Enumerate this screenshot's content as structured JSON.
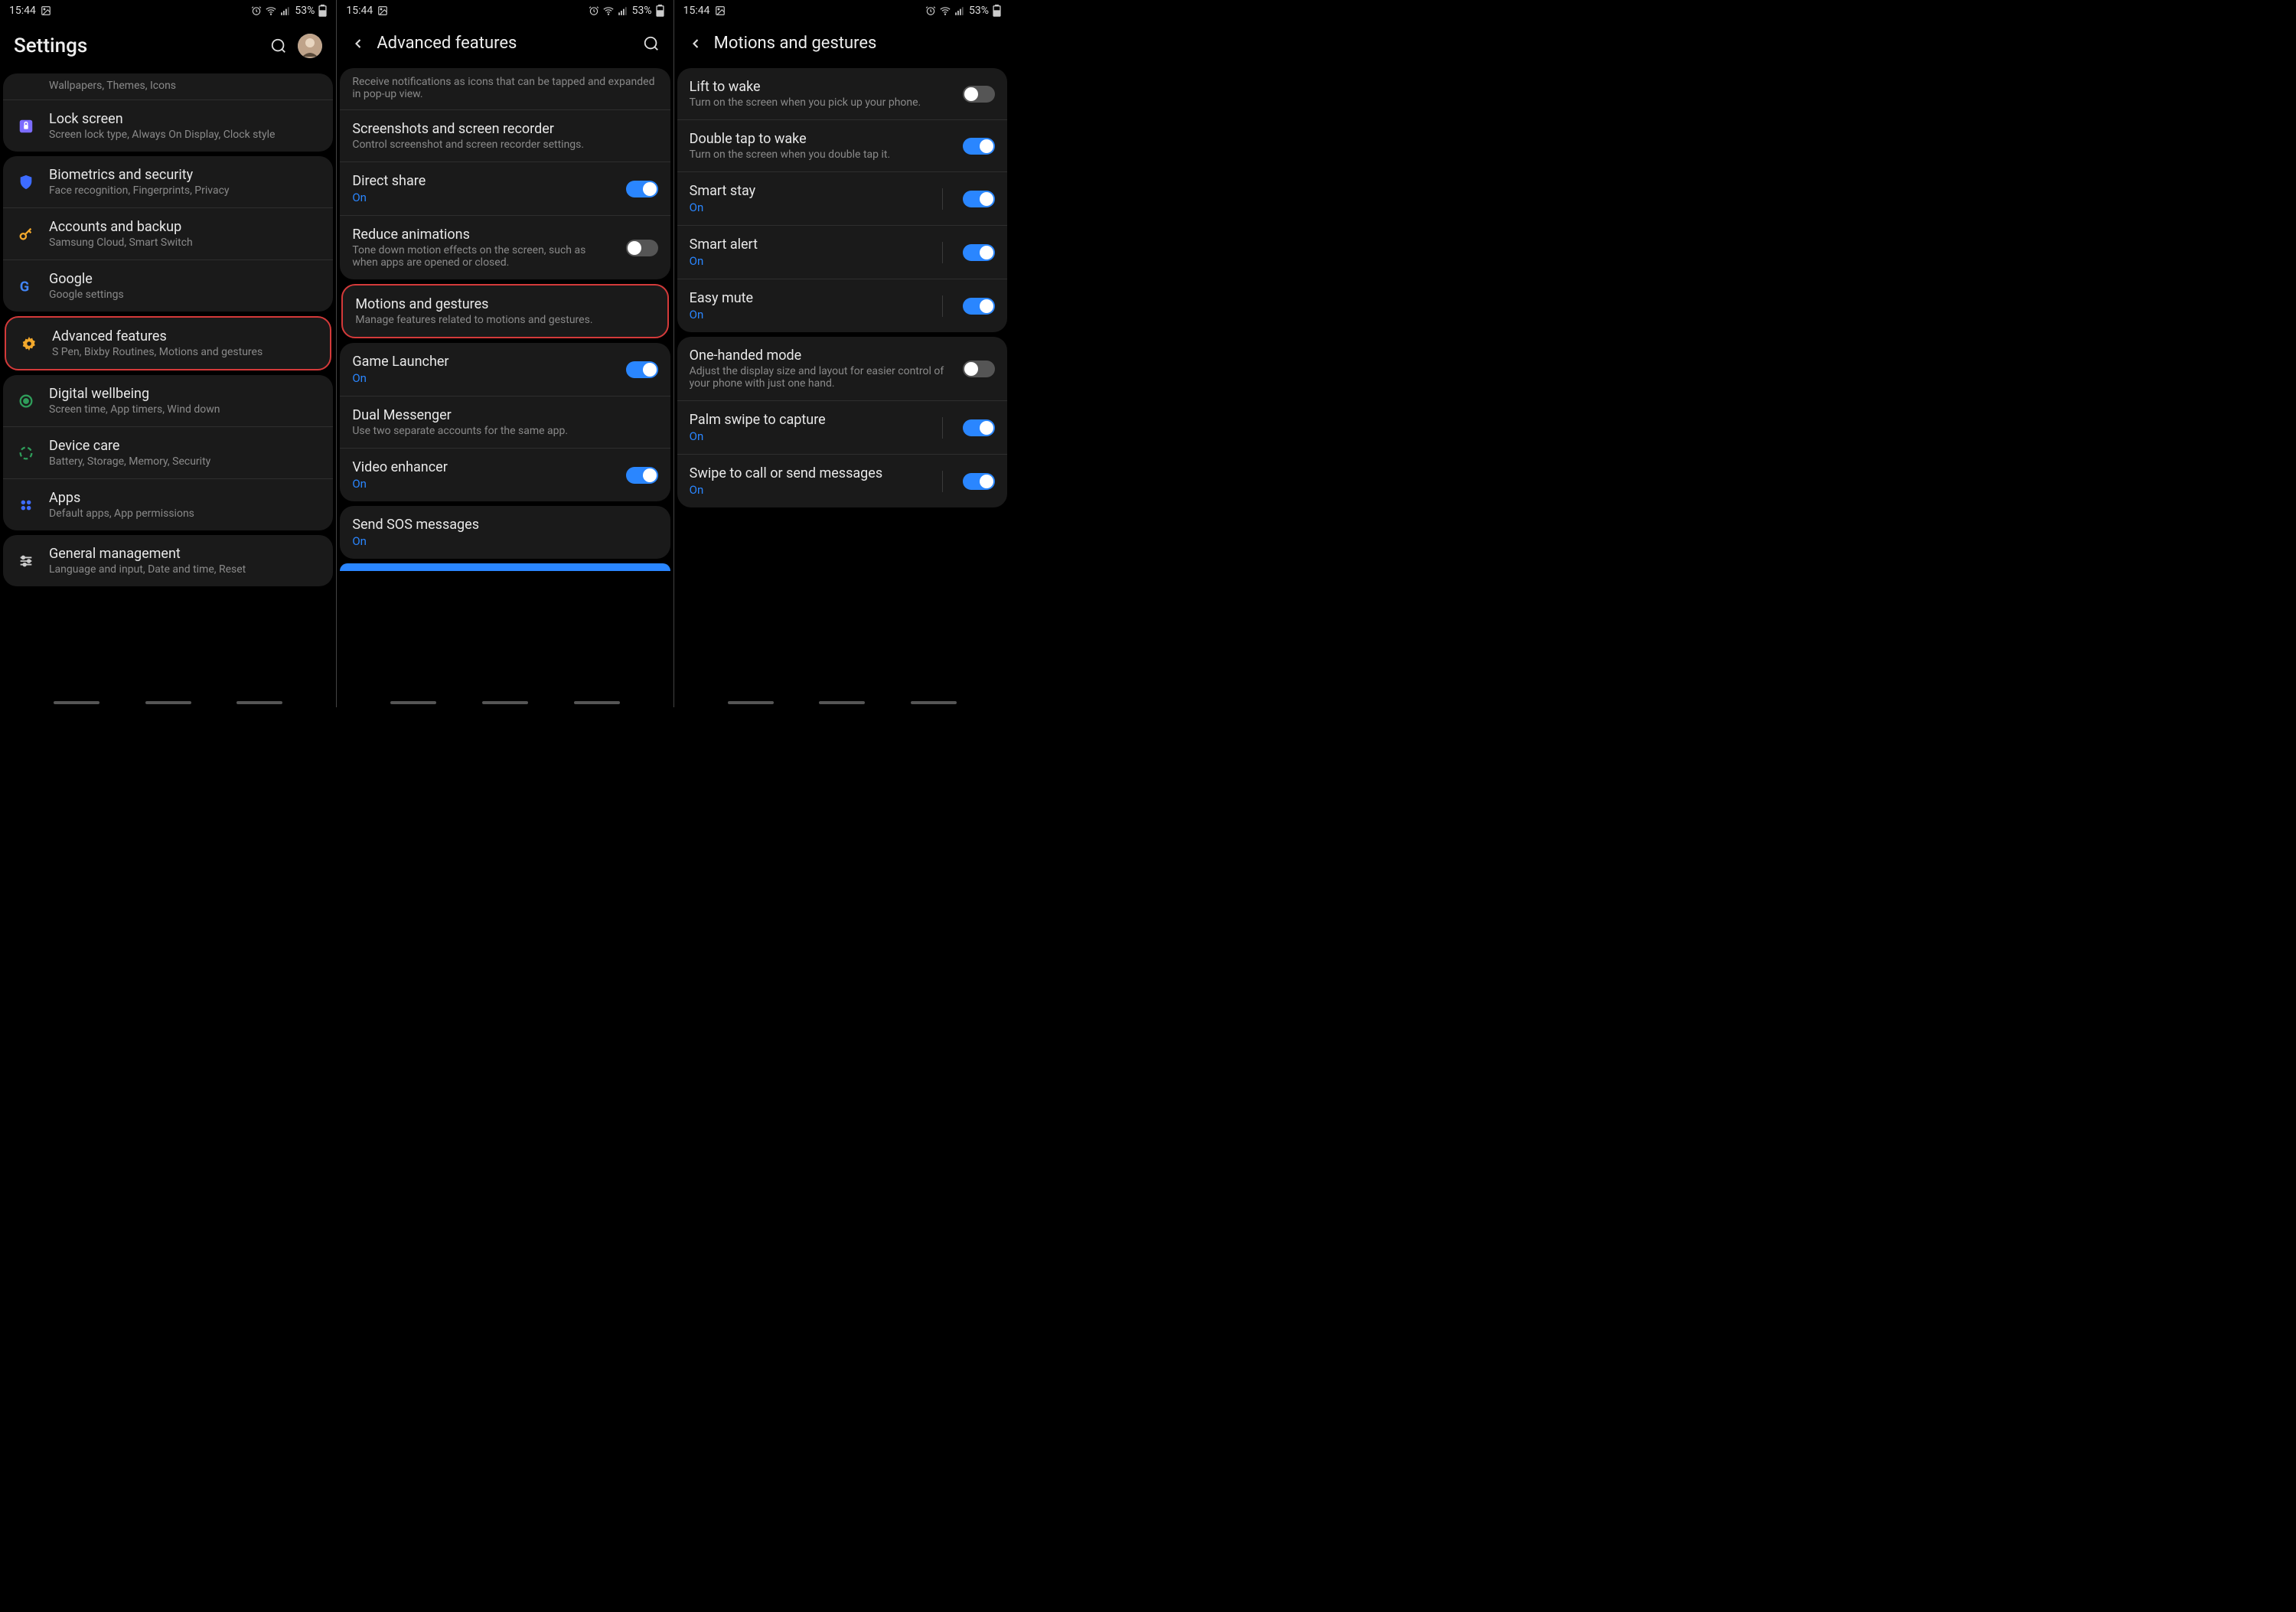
{
  "status": {
    "time": "15:44",
    "battery": "53%"
  },
  "colors": {
    "accent": "#2a86ff",
    "highlight": "#d43a3a"
  },
  "screen1": {
    "title": "Settings",
    "truncated_sub": "Wallpapers, Themes, Icons",
    "groups": [
      {
        "items": [
          {
            "icon": "lock-icon",
            "color": "#7c6cff",
            "title": "Lock screen",
            "sub": "Screen lock type, Always On Display, Clock style"
          }
        ]
      },
      {
        "items": [
          {
            "icon": "shield-icon",
            "color": "#3d6bff",
            "title": "Biometrics and security",
            "sub": "Face recognition, Fingerprints, Privacy"
          },
          {
            "icon": "key-icon",
            "color": "#f2a82c",
            "title": "Accounts and backup",
            "sub": "Samsung Cloud, Smart Switch"
          },
          {
            "icon": "google-icon",
            "color": "#4285f4",
            "title": "Google",
            "sub": "Google settings"
          }
        ]
      },
      {
        "highlight": true,
        "items": [
          {
            "icon": "gear-icon",
            "color": "#f2a82c",
            "title": "Advanced features",
            "sub": "S Pen, Bixby Routines, Motions and gestures"
          }
        ]
      },
      {
        "items": [
          {
            "icon": "wellbeing-icon",
            "color": "#2f9d5a",
            "title": "Digital wellbeing",
            "sub": "Screen time, App timers, Wind down"
          },
          {
            "icon": "care-icon",
            "color": "#2f9d5a",
            "title": "Device care",
            "sub": "Battery, Storage, Memory, Security"
          },
          {
            "icon": "apps-icon",
            "color": "#3d6bff",
            "title": "Apps",
            "sub": "Default apps, App permissions"
          }
        ]
      },
      {
        "items": [
          {
            "icon": "sliders-icon",
            "color": "#aaa",
            "title": "General management",
            "sub": "Language and input, Date and time, Reset"
          }
        ]
      }
    ]
  },
  "screen2": {
    "title": "Advanced features",
    "partial_top_sub": "Receive notifications as icons that can be tapped and expanded in pop-up view.",
    "groups": [
      {
        "items": [
          {
            "title": "Screenshots and screen recorder",
            "sub": "Control screenshot and screen recorder settings."
          },
          {
            "title": "Direct share",
            "sub_blue": "On",
            "toggle": "on"
          },
          {
            "title": "Reduce animations",
            "sub": "Tone down motion effects on the screen, such as when apps are opened or closed.",
            "toggle": "off"
          }
        ]
      },
      {
        "highlight": true,
        "items": [
          {
            "title": "Motions and gestures",
            "sub": "Manage features related to motions and gestures."
          }
        ]
      },
      {
        "items": [
          {
            "title": "Game Launcher",
            "sub_blue": "On",
            "toggle": "on"
          },
          {
            "title": "Dual Messenger",
            "sub": "Use two separate accounts for the same app."
          },
          {
            "title": "Video enhancer",
            "sub_blue": "On",
            "toggle": "on"
          }
        ]
      },
      {
        "items": [
          {
            "title": "Send SOS messages",
            "sub_blue": "On"
          }
        ]
      }
    ]
  },
  "screen3": {
    "title": "Motions and gestures",
    "groups": [
      {
        "items": [
          {
            "title": "Lift to wake",
            "sub": "Turn on the screen when you pick up your phone.",
            "toggle": "off"
          },
          {
            "title": "Double tap to wake",
            "sub": "Turn on the screen when you double tap it.",
            "toggle": "on"
          },
          {
            "title": "Smart stay",
            "sub_blue": "On",
            "toggle": "on",
            "sep": true
          },
          {
            "title": "Smart alert",
            "sub_blue": "On",
            "toggle": "on",
            "sep": true
          },
          {
            "title": "Easy mute",
            "sub_blue": "On",
            "toggle": "on",
            "sep": true
          }
        ]
      },
      {
        "items": [
          {
            "title": "One-handed mode",
            "sub": "Adjust the display size and layout for easier control of your phone with just one hand.",
            "toggle": "off"
          },
          {
            "title": "Palm swipe to capture",
            "sub_blue": "On",
            "toggle": "on",
            "sep": true
          },
          {
            "title": "Swipe to call or send messages",
            "sub_blue": "On",
            "toggle": "on",
            "sep": true
          }
        ]
      }
    ]
  }
}
